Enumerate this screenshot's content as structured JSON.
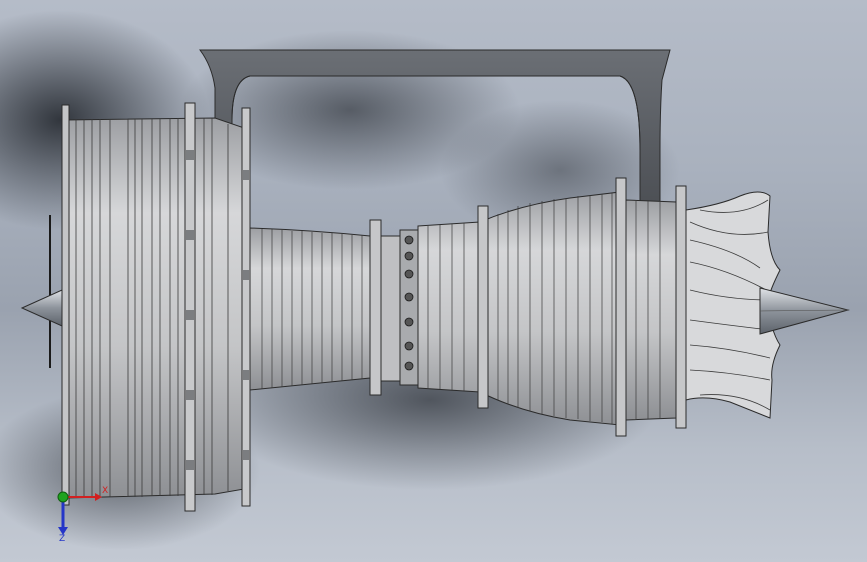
{
  "viewport": {
    "background_top": "#b5bcc8",
    "background_bottom": "#c3c9d3",
    "model_fill": "#c9cacc",
    "model_edge": "#2b2b2b",
    "pylon_fill": "#55585d"
  },
  "triad": {
    "x_label": "X",
    "y_label": "Y",
    "z_label": "Z",
    "x_color": "#d22020",
    "y_color": "#1fa31f",
    "z_color": "#2536c8"
  }
}
